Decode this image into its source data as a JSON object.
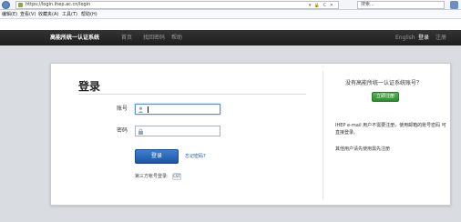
{
  "browser": {
    "url": "https://login.ihep.ac.cn/login",
    "url_actions": "▾ 🔒 C ✕",
    "search_placeholder": "搜索...",
    "menu": [
      "编辑(E)",
      "查看(V)",
      "收藏夹(A)",
      "工具(T)",
      "帮助(H)"
    ]
  },
  "site": {
    "logo": "高能所统一认证系统",
    "nav_left": [
      "首页",
      "找回密码",
      "帮助"
    ],
    "nav_right": [
      "English",
      "登录",
      "注册"
    ],
    "active_nav": "登录"
  },
  "login": {
    "title": "登录",
    "username_label": "账号",
    "password_label": "密码",
    "submit": "登录",
    "forgot": "忘记密码?",
    "third_party": "第三方帐号登录:",
    "third_party_icon": "CST"
  },
  "side": {
    "question": "没有高能所统一认证系统账号？",
    "register": "立即注册",
    "note1": "IHEP e-mail 用户不需要注册，使用邮箱的账号密码 可直接登录。",
    "note2": "其他用户请先使用需先注册"
  },
  "colors": {
    "header": "#2c2c2c",
    "primary": "#1f5fb0",
    "register": "#3a9a3a",
    "link": "#1a56a8"
  }
}
